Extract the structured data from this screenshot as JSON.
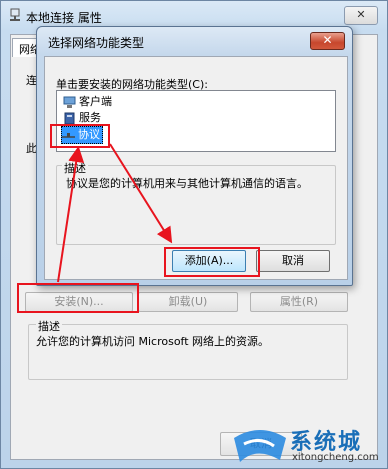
{
  "background_window": {
    "title": "本地连接 属性",
    "tab_partial": "网络",
    "edge_chars": [
      "连",
      "此"
    ],
    "buttons": {
      "install": "安装(N)...",
      "uninstall": "卸载(U)",
      "properties": "属性(R)"
    },
    "description_label": "描述",
    "description_text": "允许您的计算机访问 Microsoft 网络上的资源。",
    "cancel_label": "取消"
  },
  "dialog": {
    "title": "选择网络功能类型",
    "close_glyph": "✕",
    "prompt": "单击要安装的网络功能类型(C):",
    "items": [
      {
        "label": "客户端",
        "icon": "client-icon"
      },
      {
        "label": "服务",
        "icon": "service-icon"
      },
      {
        "label": "协议",
        "icon": "protocol-icon",
        "selected": true
      }
    ],
    "description_label": "描述",
    "description_text": "协议是您的计算机用来与其他计算机通信的语言。",
    "add_label": "添加(A)...",
    "cancel_label": "取消"
  },
  "watermark": {
    "brand": "系统城",
    "url": "xitongcheng.com"
  },
  "colors": {
    "annotation_red": "#e8141e",
    "selection_blue": "#3399ff",
    "close_red": "#c7472d"
  }
}
